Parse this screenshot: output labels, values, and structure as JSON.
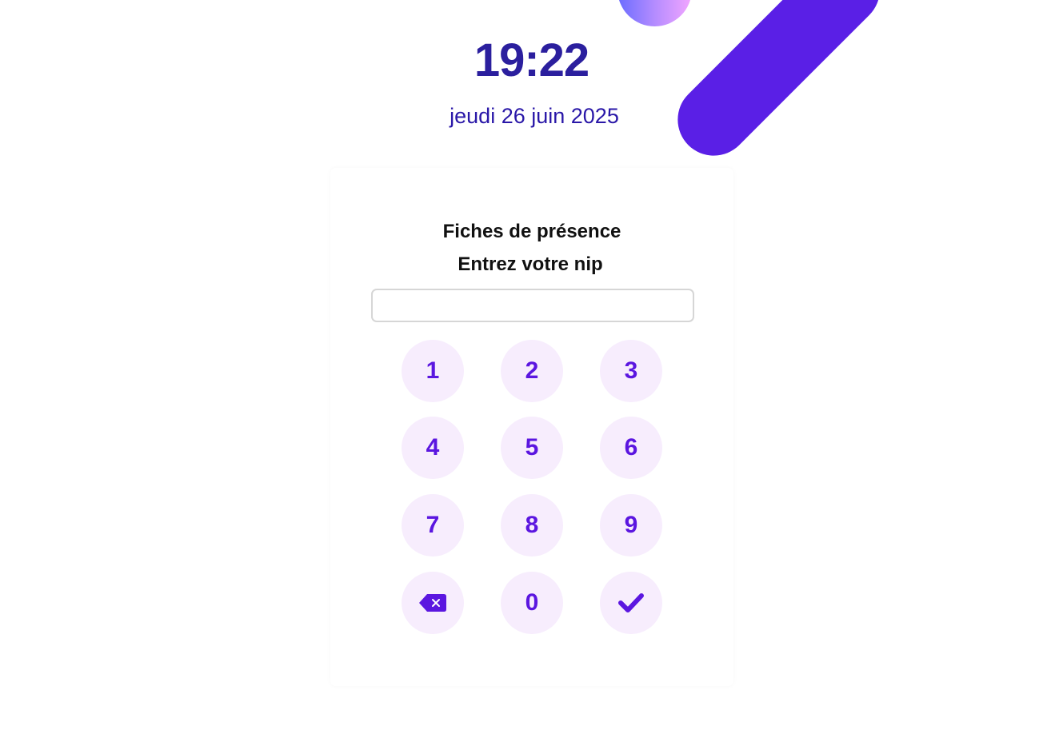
{
  "clock": {
    "time": "19:22"
  },
  "date": {
    "text": "jeudi 26 juin 2025"
  },
  "login_card": {
    "title": "Fiches de présence",
    "subtitle": "Entrez votre nip",
    "pin_input": {
      "value": "",
      "placeholder": ""
    },
    "keypad": {
      "keys": [
        "1",
        "2",
        "3",
        "4",
        "5",
        "6",
        "7",
        "8",
        "9",
        "0"
      ],
      "backspace_icon": "backspace-icon",
      "confirm_icon": "checkmark-icon"
    }
  },
  "colors": {
    "accent": "#5b16e0",
    "key_background": "#f7edfd",
    "clock_text": "#2b1f9e",
    "decor_bar": "#5a1fe6"
  }
}
